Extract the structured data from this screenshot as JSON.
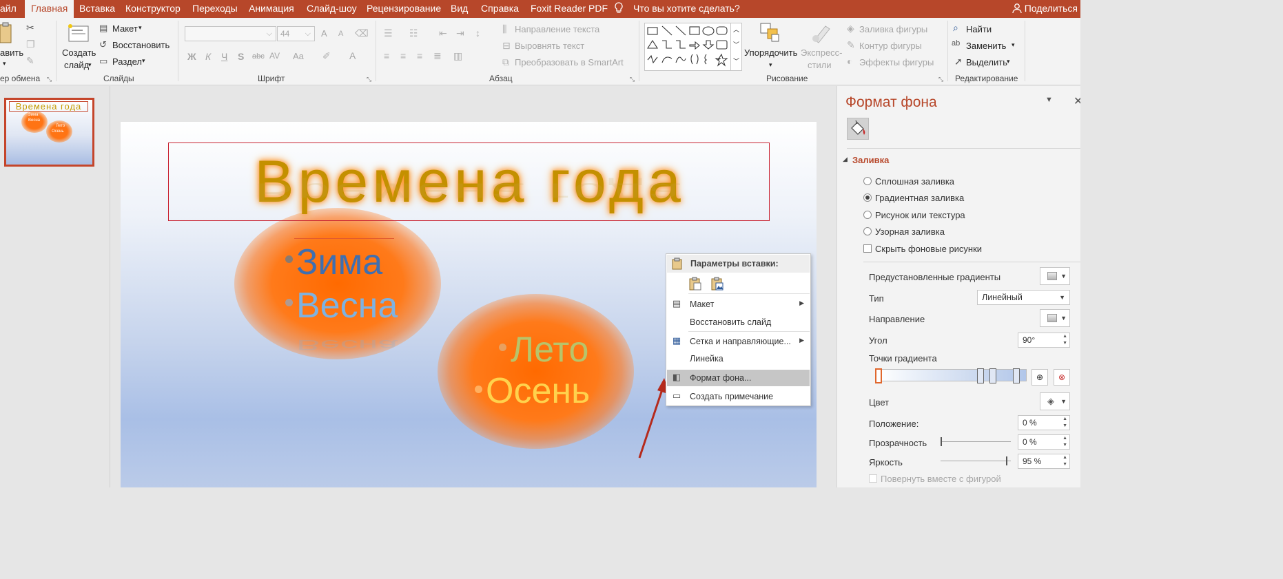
{
  "ribbon_tabs": [
    "айл",
    "Главная",
    "Вставка",
    "Конструктор",
    "Переходы",
    "Анимация",
    "Слайд-шоу",
    "Рецензирование",
    "Вид",
    "Справка",
    "Foxit Reader PDF"
  ],
  "tell_me": "Что вы хотите сделать?",
  "share": "Поделиться",
  "clipboard": {
    "paste": "авить",
    "group": "ер обмена"
  },
  "slides_group": {
    "new_slide_line1": "Создать",
    "new_slide_line2": "слайд",
    "layout": "Макет",
    "reset": "Восстановить",
    "section": "Раздел",
    "group": "Слайды"
  },
  "font_group": {
    "size": "44",
    "bold": "Ж",
    "italic": "К",
    "underline": "Ч",
    "shadow": "S",
    "strike": "abc",
    "spacing": "AV",
    "case": "Aa",
    "grow": "A",
    "shrink": "A",
    "color": "A",
    "group": "Шрифт"
  },
  "paragraph_group": {
    "text_direction": "Направление текста",
    "align_text": "Выровнять текст",
    "smartart": "Преобразовать в SmartArt",
    "group": "Абзац"
  },
  "drawing_group": {
    "arrange": "Упорядочить",
    "quick_styles_line1": "Экспресс-",
    "quick_styles_line2": "стили",
    "shape_fill": "Заливка фигуры",
    "shape_outline": "Контур фигуры",
    "shape_effects": "Эффекты фигуры",
    "group": "Рисование"
  },
  "editing_group": {
    "find": "Найти",
    "replace": "Заменить",
    "select": "Выделить",
    "group": "Редактирование"
  },
  "thumbnail": {
    "title": "Времена года",
    "item1": "Зима",
    "item2": "Весна",
    "item3": "Лето",
    "item4": "Осень"
  },
  "slide": {
    "title": "Времена года",
    "items": [
      "Зима",
      "Весна",
      "Лето",
      "Осень"
    ],
    "colors": {
      "title": "#c49000",
      "zima": "#3f6fb0",
      "vesna": "#7fb2e0",
      "leto": "#b8c46a",
      "osen": "#ffd24d"
    }
  },
  "context_menu": {
    "header": "Параметры вставки:",
    "items": [
      {
        "label": "Макет",
        "icon": "layout-icon",
        "submenu": true
      },
      {
        "label": "Восстановить слайд",
        "icon": "",
        "submenu": false
      },
      {
        "label": "Сетка и направляющие...",
        "icon": "grid-icon",
        "submenu": true
      },
      {
        "label": "Линейка",
        "icon": "",
        "submenu": false
      },
      {
        "label": "Формат фона...",
        "icon": "format-background-icon",
        "submenu": false,
        "highlighted": true
      },
      {
        "label": "Создать примечание",
        "icon": "comment-icon",
        "submenu": false
      }
    ]
  },
  "format_pane": {
    "title": "Формат фона",
    "section": "Заливка",
    "fill_options": [
      {
        "label": "Сплошная заливка",
        "selected": false
      },
      {
        "label": "Градиентная заливка",
        "selected": true
      },
      {
        "label": "Рисунок или текстура",
        "selected": false
      },
      {
        "label": "Узорная заливка",
        "selected": false
      }
    ],
    "hide_bg": "Скрыть фоновые рисунки",
    "preset": "Предустановленные градиенты",
    "type_label": "Тип",
    "type_value": "Линейный",
    "direction": "Направление",
    "angle_label": "Угол",
    "angle_value": "90°",
    "stops_label": "Точки градиента",
    "color_label": "Цвет",
    "position_label": "Положение:",
    "position_value": "0 %",
    "transparency_label": "Прозрачность",
    "transparency_value": "0 %",
    "transparency_level": 0.0,
    "brightness_label": "Яркость",
    "brightness_value": "95 %",
    "brightness_level": 0.95,
    "rotate_with_shape": "Повернуть вместе с фигурой",
    "accent": "#b7472a"
  }
}
